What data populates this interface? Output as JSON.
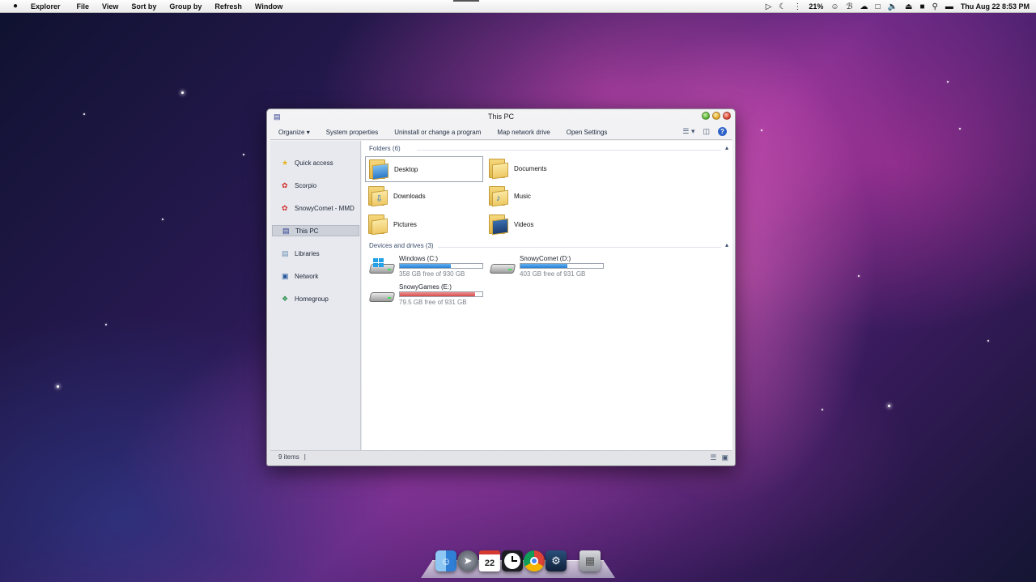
{
  "menubar": {
    "apple": "",
    "app_name": "Explorer",
    "items": [
      "File",
      "View",
      "Sort by",
      "Group by",
      "Refresh",
      "Window"
    ],
    "battery": "21%",
    "clock": "Thu Aug 22 8:53 PM"
  },
  "window": {
    "title": "This PC",
    "toolbar": {
      "organize": "Organize",
      "system_properties": "System properties",
      "uninstall": "Uninstall or change a program",
      "map_drive": "Map network drive",
      "open_settings": "Open Settings",
      "help": "?"
    },
    "sidebar": {
      "items": [
        {
          "label": "Quick access",
          "icon": "star-icon"
        },
        {
          "label": "Scorpio",
          "icon": "user-icon"
        },
        {
          "label": "SnowyComet - MMD",
          "icon": "user-icon"
        },
        {
          "label": "This PC",
          "icon": "computer-icon",
          "selected": true
        },
        {
          "label": "Libraries",
          "icon": "libraries-icon"
        },
        {
          "label": "Network",
          "icon": "network-icon"
        },
        {
          "label": "Homegroup",
          "icon": "homegroup-icon"
        }
      ]
    },
    "folders_header": "Folders (6)",
    "folders": [
      {
        "label": "Desktop",
        "icon": "desktop-folder-icon"
      },
      {
        "label": "Documents",
        "icon": "documents-folder-icon"
      },
      {
        "label": "Downloads",
        "icon": "downloads-folder-icon"
      },
      {
        "label": "Music",
        "icon": "music-folder-icon"
      },
      {
        "label": "Pictures",
        "icon": "pictures-folder-icon"
      },
      {
        "label": "Videos",
        "icon": "videos-folder-icon"
      }
    ],
    "drives_header": "Devices and drives (3)",
    "drives": [
      {
        "name": "Windows (C:)",
        "free": "358 GB free of 930 GB",
        "used_fraction": 0.615,
        "color": "#2781d6"
      },
      {
        "name": "SnowyComet (D:)",
        "free": "403 GB free of 931 GB",
        "used_fraction": 0.567,
        "color": "#2781d6"
      },
      {
        "name": "SnowyGames (E:)",
        "free": "79.5 GB free of 931 GB",
        "used_fraction": 0.915,
        "color": "#d64f4f"
      }
    ],
    "status": "9 items"
  },
  "dock": {
    "calendar_day": "22",
    "items": [
      "finder-icon",
      "launchpad-icon",
      "calendar-icon",
      "clock-icon",
      "chrome-icon",
      "steam-icon",
      "trash-icon"
    ]
  }
}
